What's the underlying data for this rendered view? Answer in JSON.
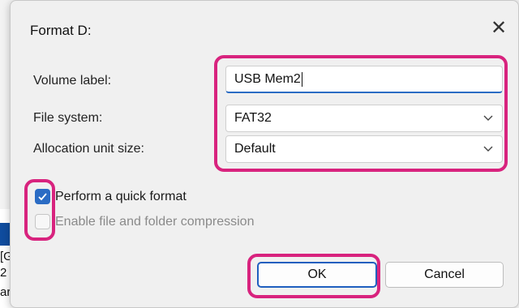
{
  "background": {
    "fragments": [
      "[G",
      "2",
      "ar"
    ]
  },
  "dialog": {
    "title": "Format D:",
    "close_icon": "close-icon",
    "volume_label": {
      "label": "Volume label:",
      "value": "USB Mem2"
    },
    "file_system": {
      "label": "File system:",
      "value": "FAT32"
    },
    "allocation_unit_size": {
      "label": "Allocation unit size:",
      "value": "Default"
    },
    "quick_format": {
      "label": "Perform a quick format",
      "checked": true
    },
    "compression": {
      "label": "Enable file and folder compression",
      "checked": false,
      "enabled": false
    },
    "ok_label": "OK",
    "cancel_label": "Cancel"
  },
  "colors": {
    "accent": "#2b6cc4",
    "highlight": "#d8237e"
  }
}
